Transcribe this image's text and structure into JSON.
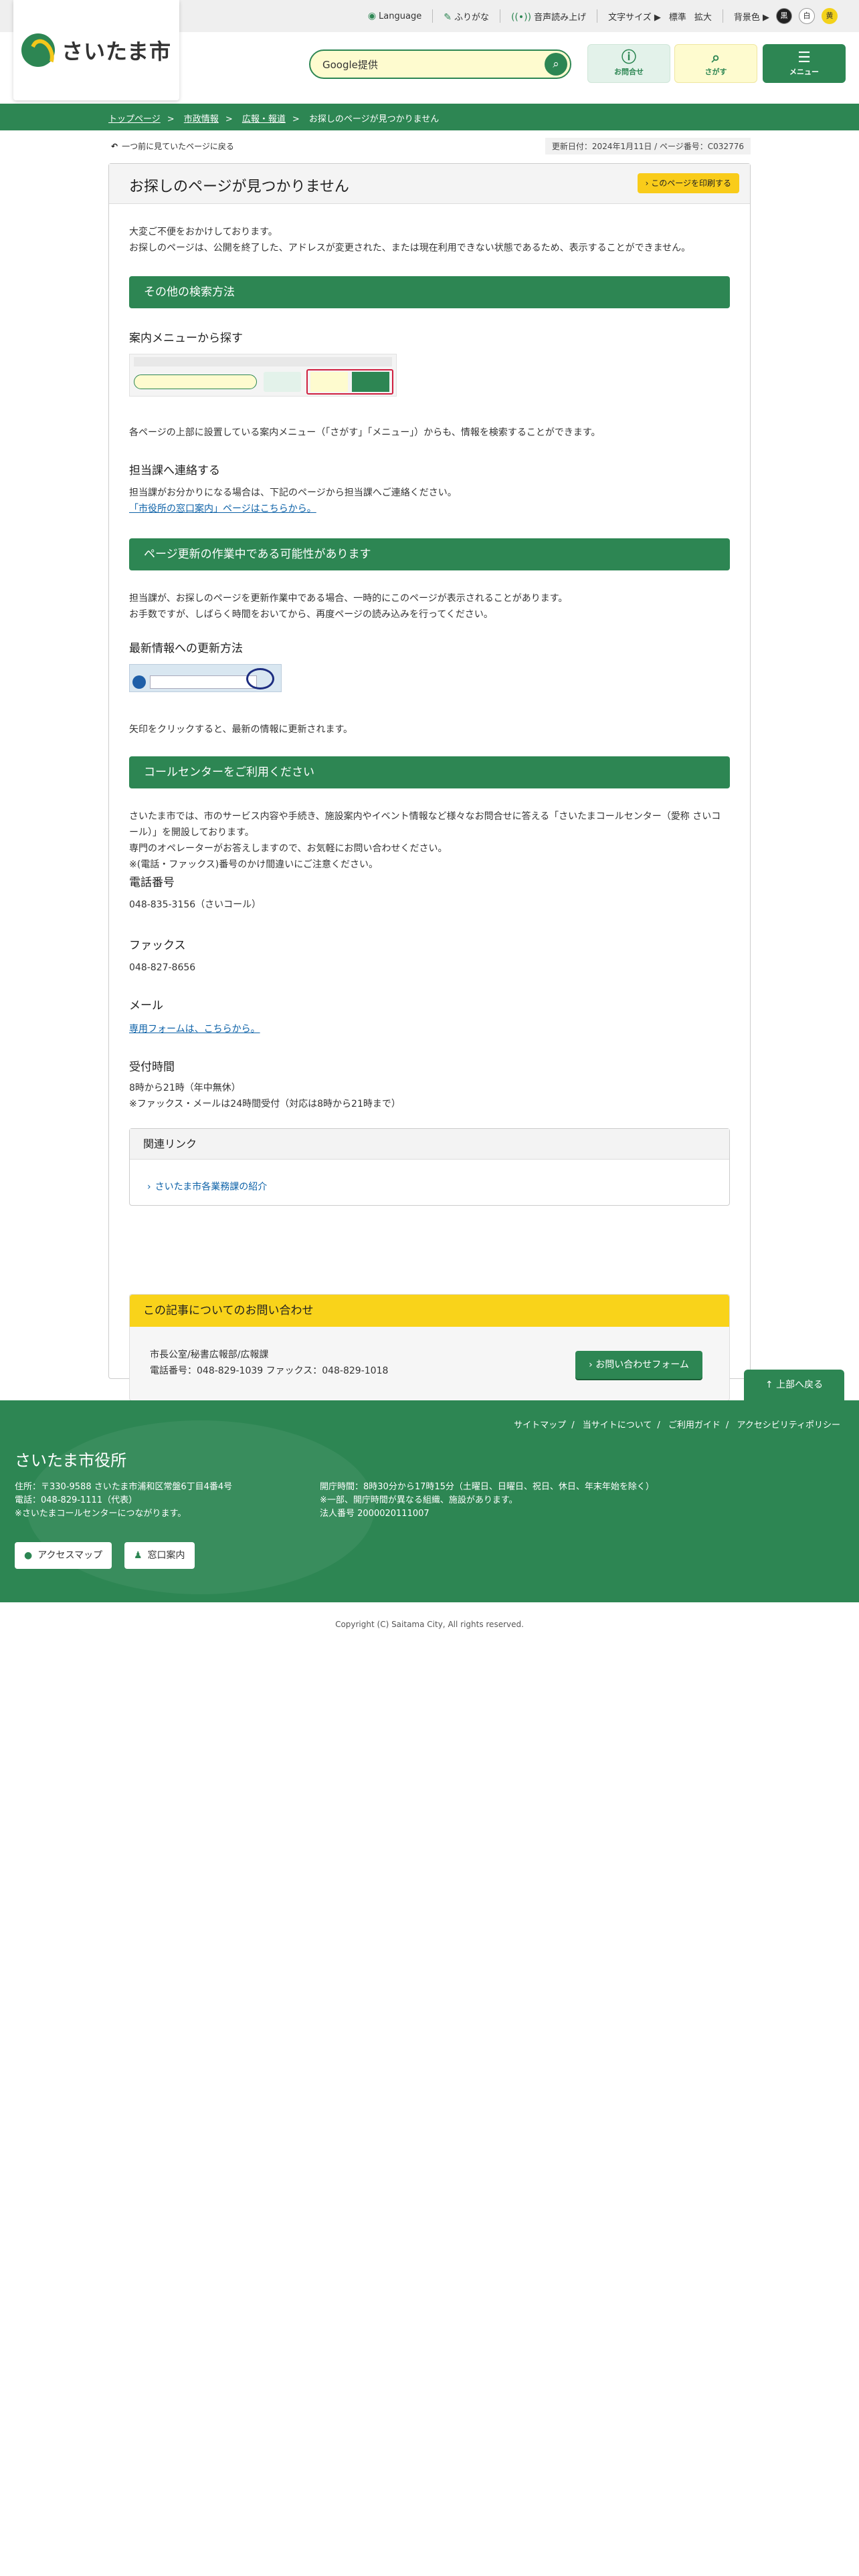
{
  "util": {
    "language": "Language",
    "furigana": "ふりがな",
    "voice": "音声読み上げ",
    "font_size_label": "文字サイズ ▶",
    "font_std": "標準",
    "font_large": "拡大",
    "bg_label": "背景色 ▶",
    "bg_black": "黒",
    "bg_white": "白",
    "bg_yellow": "黄"
  },
  "header": {
    "logo": "さいたま市",
    "search_placeholder": "Google提供",
    "contact": "お問合せ",
    "sagasu": "さがす",
    "menu": "メニュー"
  },
  "breadcrumb": {
    "items": [
      "トップページ",
      "市政情報",
      "広報・報道"
    ],
    "current": "お探しのページが見つかりません"
  },
  "back_link": "一つ前に見ていたページに戻る",
  "update_info": "更新日付：2024年1月11日 / ページ番号：C032776",
  "title": "お探しのページが見つかりません",
  "print_button": "このページを印刷する",
  "intro": [
    "大変ご不便をおかけしております。",
    "お探しのページは、公開を終了した、アドレスが変更された、または現在利用できない状態であるため、表示することができません。"
  ],
  "sec1": {
    "heading": "その他の検索方法",
    "sub1": "案内メニューから探す",
    "text1": "各ページの上部に設置している案内メニュー（「さがす」「メニュー」）からも、情報を検索することができます。",
    "sub2": "担当課へ連絡する",
    "text2": "担当課がお分かりになる場合は、下記のページから担当課へご連絡ください。",
    "link2": "「市役所の窓口案内」ページはこちらから。"
  },
  "sec2": {
    "heading": "ページ更新の作業中である可能性があります",
    "text": [
      "担当課が、お探しのページを更新作業中である場合、一時的にこのページが表示されることがあります。",
      "お手数ですが、しばらく時間をおいてから、再度ページの読み込みを行ってください。"
    ],
    "sub": "最新情報への更新方法",
    "caption": "矢印をクリックすると、最新の情報に更新されます。"
  },
  "sec3": {
    "heading": "コールセンターをご利用ください",
    "text": [
      "さいたま市では、市のサービス内容や手続き、施設案内やイベント情報など様々なお問合せに答える「さいたまコールセンター（愛称 さいコール）」を開設しております。",
      "専門のオペレーターがお答えしますので、お気軽にお問い合わせください。",
      "※(電話・ファックス)番号のかけ間違いにご注意ください。"
    ],
    "tel_label": "電話番号",
    "tel": "048-835-3156（さいコール）",
    "fax_label": "ファックス",
    "fax": "048-827-8656",
    "mail_label": "メール",
    "mail_link": "専用フォームは、こちらから。",
    "hours_label": "受付時間",
    "hours": [
      "8時から21時（年中無休）",
      "※ファックス・メールは24時間受付（対応は8時から21時まで）"
    ]
  },
  "related": {
    "heading": "関連リンク",
    "items": [
      "さいたま市各業務課の紹介"
    ]
  },
  "inquiry": {
    "heading": "この記事についてのお問い合わせ",
    "dept": "市長公室/秘書広報部/広報課",
    "phone": "電話番号：048-829-1039 ファックス：048-829-1018",
    "button": "お問い合わせフォーム"
  },
  "page_top": "上部へ戻る",
  "footer": {
    "links": [
      "サイトマップ",
      "当サイトについて",
      "ご利用ガイド",
      "アクセシビリティポリシー"
    ],
    "title": "さいたま市役所",
    "address": [
      "住所：〒330-9588 さいたま市浦和区常盤6丁目4番4号",
      "電話：048-829-1111（代表）",
      "※さいたまコールセンターにつながります。"
    ],
    "hours": [
      "開庁時間：8時30分から17時15分（土曜日、日曜日、祝日、休日、年末年始を除く）",
      "※一部、開庁時間が異なる組織、施設があります。",
      "法人番号 2000020111007"
    ],
    "access": "アクセスマップ",
    "counter": "窓口案内"
  },
  "copyright": "Copyright (C) Saitama City, All rights reserved."
}
